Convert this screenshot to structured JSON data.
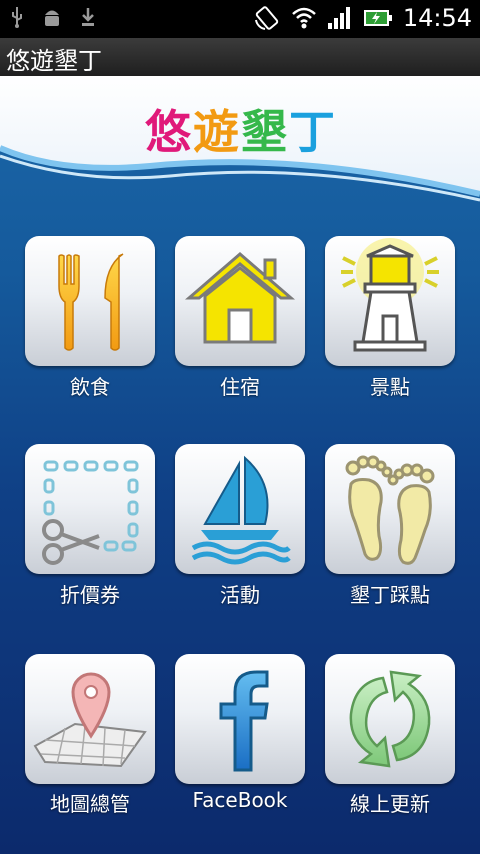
{
  "status_bar": {
    "time": "14:54",
    "icons": [
      "usb-icon",
      "android-debug-icon",
      "download-icon",
      "rotate-icon",
      "wifi-icon",
      "signal-icon",
      "battery-icon"
    ]
  },
  "titlebar": {
    "title": "悠遊墾丁"
  },
  "logo": {
    "chars": [
      "悠",
      "遊",
      "墾",
      "丁"
    ],
    "colors": [
      "#e0197a",
      "#f29a12",
      "#35b84b",
      "#1aa0de"
    ]
  },
  "menu": [
    {
      "label": "飲食",
      "icon": "fork-knife-icon"
    },
    {
      "label": "住宿",
      "icon": "house-icon"
    },
    {
      "label": "景點",
      "icon": "lighthouse-icon"
    },
    {
      "label": "折價券",
      "icon": "coupon-scissors-icon"
    },
    {
      "label": "活動",
      "icon": "sailboat-icon"
    },
    {
      "label": "墾丁踩點",
      "icon": "footprints-icon"
    },
    {
      "label": "地圖總管",
      "icon": "map-pin-icon"
    },
    {
      "label": "FaceBook",
      "icon": "facebook-icon"
    },
    {
      "label": "線上更新",
      "icon": "refresh-icon"
    }
  ]
}
